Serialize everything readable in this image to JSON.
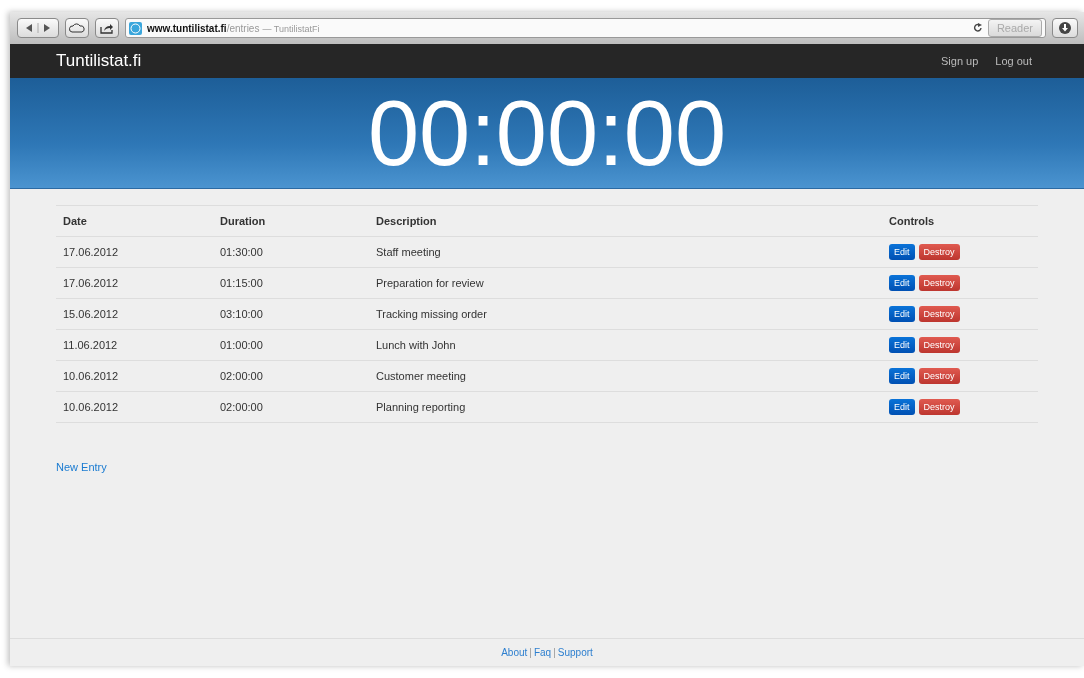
{
  "browser": {
    "url_host": "www.tuntilistat.fi",
    "url_path": "/entries",
    "page_title": "— TuntilistatFi",
    "reader": "Reader"
  },
  "navbar": {
    "brand": "Tuntilistat.fi",
    "links": [
      "Sign up",
      "Log out"
    ]
  },
  "timer": "00:00:00",
  "table": {
    "columns": [
      "Date",
      "Duration",
      "Description",
      "Controls"
    ],
    "rows": [
      {
        "date": "17.06.2012",
        "duration": "01:30:00",
        "description": "Staff meeting",
        "edit": "Edit",
        "destroy": "Destroy"
      },
      {
        "date": "17.06.2012",
        "duration": "01:15:00",
        "description": "Preparation for review",
        "edit": "Edit",
        "destroy": "Destroy"
      },
      {
        "date": "15.06.2012",
        "duration": "03:10:00",
        "description": "Tracking missing order",
        "edit": "Edit",
        "destroy": "Destroy"
      },
      {
        "date": "11.06.2012",
        "duration": "01:00:00",
        "description": "Lunch with John",
        "edit": "Edit",
        "destroy": "Destroy"
      },
      {
        "date": "10.06.2012",
        "duration": "02:00:00",
        "description": "Customer meeting",
        "edit": "Edit",
        "destroy": "Destroy"
      },
      {
        "date": "10.06.2012",
        "duration": "02:00:00",
        "description": "Planning reporting",
        "edit": "Edit",
        "destroy": "Destroy"
      }
    ]
  },
  "new_entry": "New Entry",
  "footer": [
    {
      "kind": "link",
      "text": "About"
    },
    {
      "kind": "separator",
      "text": "|"
    },
    {
      "kind": "link",
      "text": "Faq"
    },
    {
      "kind": "separator",
      "text": "|"
    },
    {
      "kind": "link",
      "text": "Support"
    }
  ]
}
